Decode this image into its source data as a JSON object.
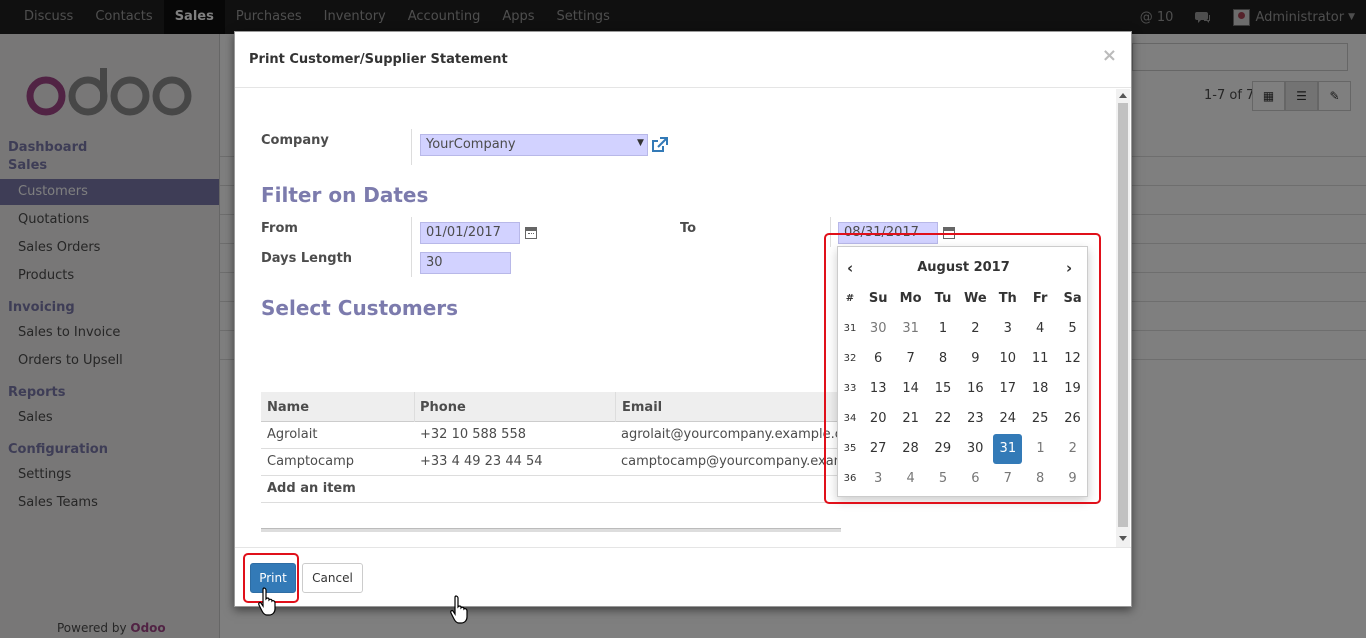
{
  "topbar": {
    "menu": [
      "Discuss",
      "Contacts",
      "Sales",
      "Purchases",
      "Inventory",
      "Accounting",
      "Apps",
      "Settings"
    ],
    "active": "Sales",
    "notifications": "@ 10",
    "user": "Administrator"
  },
  "sidebar": {
    "logo_text": "odoo",
    "dashboard": "Dashboard",
    "sales_head": "Sales",
    "items_sales": [
      "Customers",
      "Quotations",
      "Sales Orders",
      "Products"
    ],
    "invoicing_head": "Invoicing",
    "items_invoicing": [
      "Sales to Invoice",
      "Orders to Upsell"
    ],
    "reports_head": "Reports",
    "items_reports": [
      "Sales"
    ],
    "config_head": "Configuration",
    "items_config": [
      "Settings",
      "Sales Teams"
    ],
    "powered": "Powered by",
    "powered_brand": "Odoo"
  },
  "main": {
    "pager": "1-7 of 7"
  },
  "modal": {
    "title": "Print Customer/Supplier Statement",
    "close": "×",
    "company_label": "Company",
    "company_value": "YourCompany",
    "filter_title": "Filter on Dates",
    "from_label": "From",
    "from_value": "01/01/2017",
    "to_label": "To",
    "to_value": "08/31/2017",
    "days_label": "Days Length",
    "days_value": "30",
    "select_title": "Select Customers",
    "table": {
      "headers": [
        "Name",
        "Phone",
        "Email"
      ],
      "rows": [
        {
          "name": "Agrolait",
          "phone": "+32 10 588 558",
          "email": "agrolait@yourcompany.example.com"
        },
        {
          "name": "Camptocamp",
          "phone": "+33 4 49 23 44 54",
          "email": "camptocamp@yourcompany.example.com"
        }
      ],
      "add_item": "Add an item"
    },
    "print_label": "Print",
    "cancel_label": "Cancel"
  },
  "datepicker": {
    "prev": "‹",
    "next": "›",
    "month": "August 2017",
    "headers": [
      "#",
      "Su",
      "Mo",
      "Tu",
      "We",
      "Th",
      "Fr",
      "Sa"
    ],
    "weeks": [
      {
        "wk": "31",
        "days": [
          "30",
          "31",
          "1",
          "2",
          "3",
          "4",
          "5"
        ],
        "old": [
          0,
          1
        ]
      },
      {
        "wk": "32",
        "days": [
          "6",
          "7",
          "8",
          "9",
          "10",
          "11",
          "12"
        ],
        "old": []
      },
      {
        "wk": "33",
        "days": [
          "13",
          "14",
          "15",
          "16",
          "17",
          "18",
          "19"
        ],
        "old": []
      },
      {
        "wk": "34",
        "days": [
          "20",
          "21",
          "22",
          "23",
          "24",
          "25",
          "26"
        ],
        "old": []
      },
      {
        "wk": "35",
        "days": [
          "27",
          "28",
          "29",
          "30",
          "31",
          "1",
          "2"
        ],
        "old": [
          5,
          6
        ]
      },
      {
        "wk": "36",
        "days": [
          "3",
          "4",
          "5",
          "6",
          "7",
          "8",
          "9"
        ],
        "old": [
          0,
          1,
          2,
          3,
          4,
          5,
          6
        ]
      }
    ],
    "selected": "31"
  },
  "colors": {
    "brand": "#7c7bad",
    "primary": "#337ab7",
    "highlight": "#e0101a",
    "field_bg": "#d2d2ff"
  }
}
